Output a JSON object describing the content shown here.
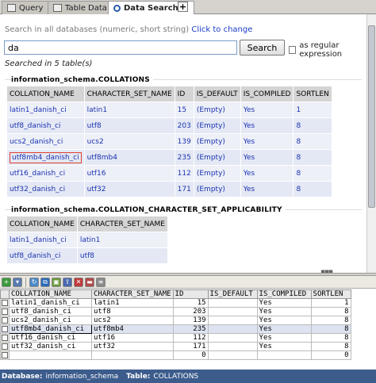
{
  "tabs": [
    {
      "label": "Query",
      "icon": "query-icon"
    },
    {
      "label": "Table Data",
      "icon": "table-icon"
    },
    {
      "label": "Data Search",
      "icon": "search-icon"
    }
  ],
  "search": {
    "hint": "Search in all databases (numeric, short string)",
    "hint_link": "Click to change",
    "value": "da",
    "button_label": "Search",
    "regex_label": "as regular expression",
    "searched_text": "Searched in 5 table(s)"
  },
  "results": [
    {
      "title": "information_schema.COLLATIONS",
      "headers": [
        "COLLATION_NAME",
        "CHARACTER_SET_NAME",
        "ID",
        "IS_DEFAULT",
        "IS_COMPILED",
        "SORTLEN"
      ],
      "rows": [
        [
          "latin1_danish_ci",
          "latin1",
          "15",
          "(Empty)",
          "Yes",
          "1"
        ],
        [
          "utf8_danish_ci",
          "utf8",
          "203",
          "(Empty)",
          "Yes",
          "8"
        ],
        [
          "ucs2_danish_ci",
          "ucs2",
          "139",
          "(Empty)",
          "Yes",
          "8"
        ],
        [
          "utf8mb4_danish_ci",
          "utf8mb4",
          "235",
          "(Empty)",
          "Yes",
          "8"
        ],
        [
          "utf16_danish_ci",
          "utf16",
          "112",
          "(Empty)",
          "Yes",
          "8"
        ],
        [
          "utf32_danish_ci",
          "utf32",
          "171",
          "(Empty)",
          "Yes",
          "8"
        ]
      ]
    },
    {
      "title": "information_schema.COLLATION_CHARACTER_SET_APPLICABILITY",
      "headers": [
        "COLLATION_NAME",
        "CHARACTER_SET_NAME"
      ],
      "rows": [
        [
          "latin1_danish_ci",
          "latin1"
        ],
        [
          "utf8_danish_ci",
          "utf8"
        ]
      ]
    }
  ],
  "grid": {
    "headers": [
      "COLLATION_NAME",
      "CHARACTER_SET_NAME",
      "ID",
      "IS_DEFAULT",
      "IS_COMPILED",
      "SORTLEN"
    ],
    "rows": [
      [
        "latin1_danish_ci",
        "latin1",
        "15",
        "",
        "Yes",
        "1"
      ],
      [
        "utf8_danish_ci",
        "utf8",
        "203",
        "",
        "Yes",
        "8"
      ],
      [
        "ucs2_danish_ci",
        "ucs2",
        "139",
        "",
        "Yes",
        "8"
      ],
      [
        "utf8mb4_danish_ci",
        "utf8mb4",
        "235",
        "",
        "Yes",
        "8"
      ],
      [
        "utf16_danish_ci",
        "utf16",
        "112",
        "",
        "Yes",
        "8"
      ],
      [
        "utf32_danish_ci",
        "utf32",
        "171",
        "",
        "Yes",
        "8"
      ],
      [
        "",
        "",
        "0",
        "",
        "",
        "0"
      ]
    ]
  },
  "status": {
    "database_label": "Database:",
    "database_value": "information_schema",
    "table_label": "Table:",
    "table_value": "COLLATIONS"
  },
  "colors": {
    "link": "#1a33b0",
    "status_bg": "#3c5c8c",
    "highlight": "#e04030"
  }
}
